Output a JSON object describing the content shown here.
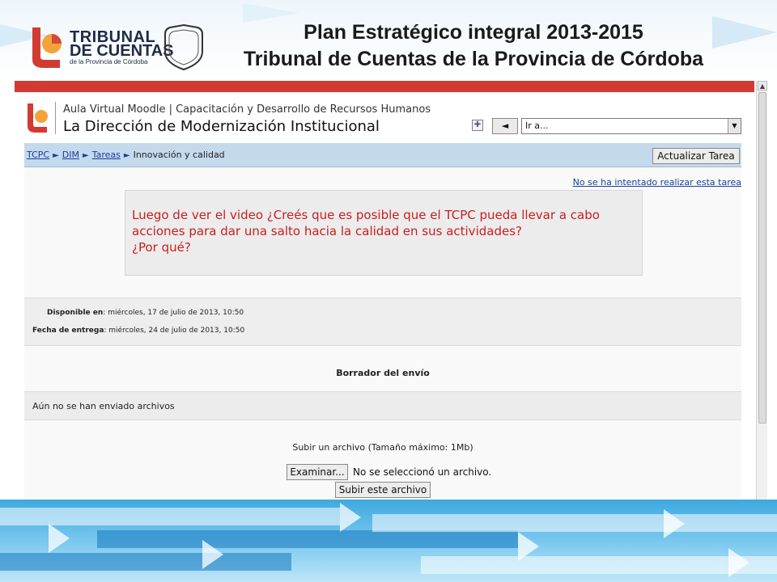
{
  "slide": {
    "title_line1": "Plan Estratégico integral 2013-2015",
    "title_line2": "Tribunal de Cuentas de la Provincia de Córdoba",
    "logo": {
      "line1": "TRIBUNAL",
      "line2": "DE CUENTAS",
      "line3": "de la Provincia de Córdoba"
    }
  },
  "colors": {
    "brand_red": "#d23b32",
    "brand_orange": "#f2a33a",
    "navbar_blue": "#c4d9ec",
    "link_blue": "#1a3f9c",
    "question_red": "#cc1d1d"
  },
  "header": {
    "site_subtitle": "Aula Virtual Moodle | Capacitación y Desarrollo de Recursos Humanos",
    "site_name": "La Dirección de Modernización Institucional",
    "language_icon": "flag-icon",
    "back_button": "◄",
    "jump_select_value": "Ir a..."
  },
  "navbar": {
    "crumbs": [
      "TCPC",
      "DIM",
      "Tareas"
    ],
    "current": "Innovación y calidad",
    "update_button": "Actualizar Tarea"
  },
  "assignment": {
    "not_attempted_link": "No se ha intentado realizar esta tarea",
    "question_lines": [
      "Luego de ver el video ¿Creés que es posible que el TCPC pueda llevar a cabo",
      "acciones para dar una salto hacia la calidad en sus actividades?",
      "¿Por qué?"
    ],
    "available_label": "Disponible en",
    "available_value": ": miércoles, 17 de julio de 2013, 10:50",
    "due_label": "Fecha de entrega",
    "due_value": ": miércoles, 24 de julio de 2013, 10:50"
  },
  "submission": {
    "draft_title": "Borrador del envío",
    "no_files": "Aún no se han enviado archivos",
    "upload_label": "Subir un archivo (Tamaño máximo: 1Mb)",
    "browse_button": "Examinar...",
    "no_file_selected": "No se seleccionó un archivo.",
    "submit_button": "Subir este archivo"
  }
}
